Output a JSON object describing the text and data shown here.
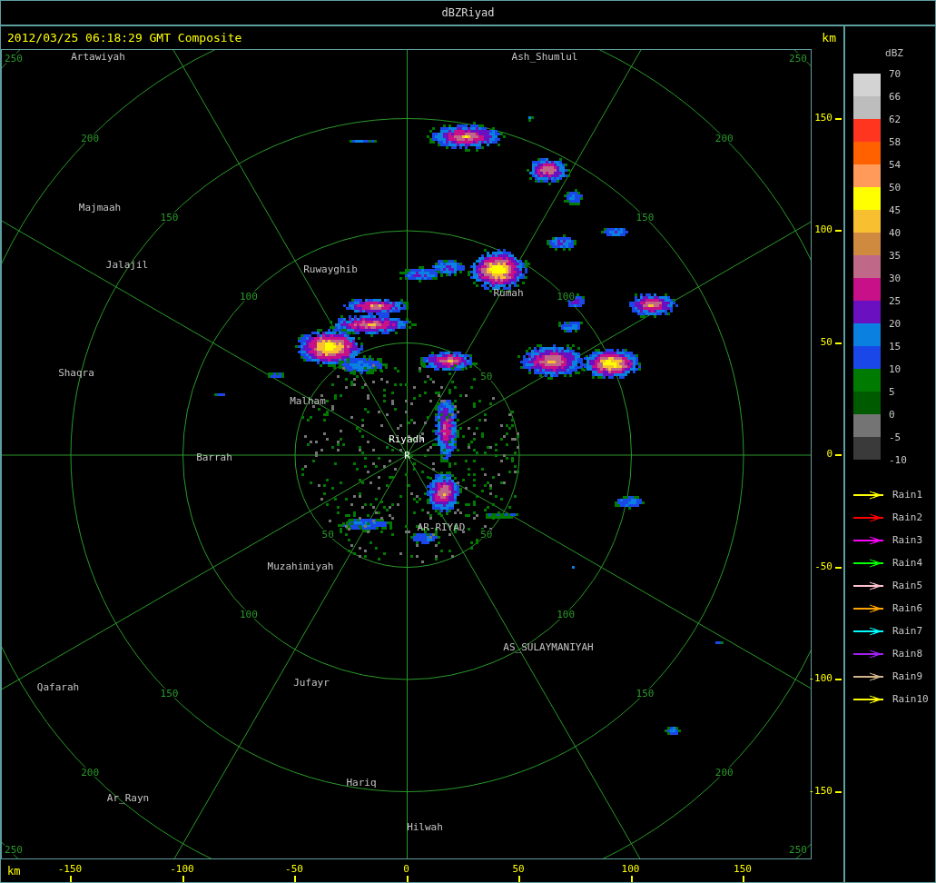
{
  "window": {
    "title": "dBZRiyad"
  },
  "header": {
    "timestamp": "2012/03/25 06:18:29 GMT Composite",
    "unit": "km"
  },
  "map": {
    "center_marker": "R",
    "places": [
      {
        "name": "Artawiyah",
        "kind": "town"
      },
      {
        "name": "Ash_Shumlul",
        "kind": "town"
      },
      {
        "name": "Majmaah",
        "kind": "town"
      },
      {
        "name": "Jalajil",
        "kind": "town"
      },
      {
        "name": "Ruwayghib",
        "kind": "town"
      },
      {
        "name": "Rumah",
        "kind": "town"
      },
      {
        "name": "Shaqra",
        "kind": "town"
      },
      {
        "name": "Malham",
        "kind": "town"
      },
      {
        "name": "Riyadh",
        "kind": "radar"
      },
      {
        "name": "Barrah",
        "kind": "town"
      },
      {
        "name": "AR-RIYAD",
        "kind": "town"
      },
      {
        "name": "Muzahimiyah",
        "kind": "town"
      },
      {
        "name": "AS_SULAYMANIYAH",
        "kind": "town"
      },
      {
        "name": "Jufayr",
        "kind": "town"
      },
      {
        "name": "Qafarah",
        "kind": "town"
      },
      {
        "name": "Hariq",
        "kind": "town"
      },
      {
        "name": "Ar_Rayn",
        "kind": "town"
      },
      {
        "name": "Hilwah",
        "kind": "town"
      }
    ],
    "range_rings": [
      {
        "labels": [
          "50",
          "50",
          "50"
        ]
      },
      {
        "labels": [
          "100",
          "100",
          "100",
          "100"
        ]
      },
      {
        "labels": [
          "150",
          "150",
          "150",
          "150"
        ]
      },
      {
        "labels": [
          "200",
          "200",
          "200",
          "200"
        ]
      },
      {
        "labels": [
          "250",
          "250",
          "250",
          "250"
        ]
      }
    ]
  },
  "y_axis": {
    "ticks": [
      "150",
      "100",
      "50",
      "0",
      "-50",
      "-100",
      "-150"
    ]
  },
  "x_axis": {
    "unit": "km",
    "ticks": [
      "-150",
      "-100",
      "-50",
      "0",
      "50",
      "100",
      "150"
    ]
  },
  "legend": {
    "title": "dBZ",
    "scale": [
      {
        "color": "#d3d3d3"
      },
      {
        "color": "#bdbdbd"
      },
      {
        "color": "#ff3520"
      },
      {
        "color": "#ff6000"
      },
      {
        "color": "#ff9a5a"
      },
      {
        "color": "#ffff00"
      },
      {
        "color": "#f8c030"
      },
      {
        "color": "#d08a40"
      },
      {
        "color": "#c06888"
      },
      {
        "color": "#c81088"
      },
      {
        "color": "#6a10c0"
      },
      {
        "color": "#0a80e0"
      },
      {
        "color": "#1a48e8"
      },
      {
        "color": "#007a00"
      },
      {
        "color": "#005a00"
      },
      {
        "color": "#747474"
      },
      {
        "color": "#3a3a3a"
      }
    ],
    "scale_labels": [
      "70",
      "66",
      "62",
      "58",
      "54",
      "50",
      "45",
      "40",
      "35",
      "30",
      "25",
      "20",
      "15",
      "10",
      "5",
      "0",
      "-5",
      "-10"
    ],
    "tracks": [
      {
        "name": "Rain1",
        "color": "#ffff00"
      },
      {
        "name": "Rain2",
        "color": "#ff0000"
      },
      {
        "name": "Rain3",
        "color": "#ff00ff"
      },
      {
        "name": "Rain4",
        "color": "#00ff00"
      },
      {
        "name": "Rain5",
        "color": "#ffc0cb"
      },
      {
        "name": "Rain6",
        "color": "#ffa500"
      },
      {
        "name": "Rain7",
        "color": "#00ffff"
      },
      {
        "name": "Rain8",
        "color": "#a020f0"
      },
      {
        "name": "Rain9",
        "color": "#d2b48c"
      },
      {
        "name": "Rain10",
        "color": "#ffff00"
      }
    ]
  }
}
